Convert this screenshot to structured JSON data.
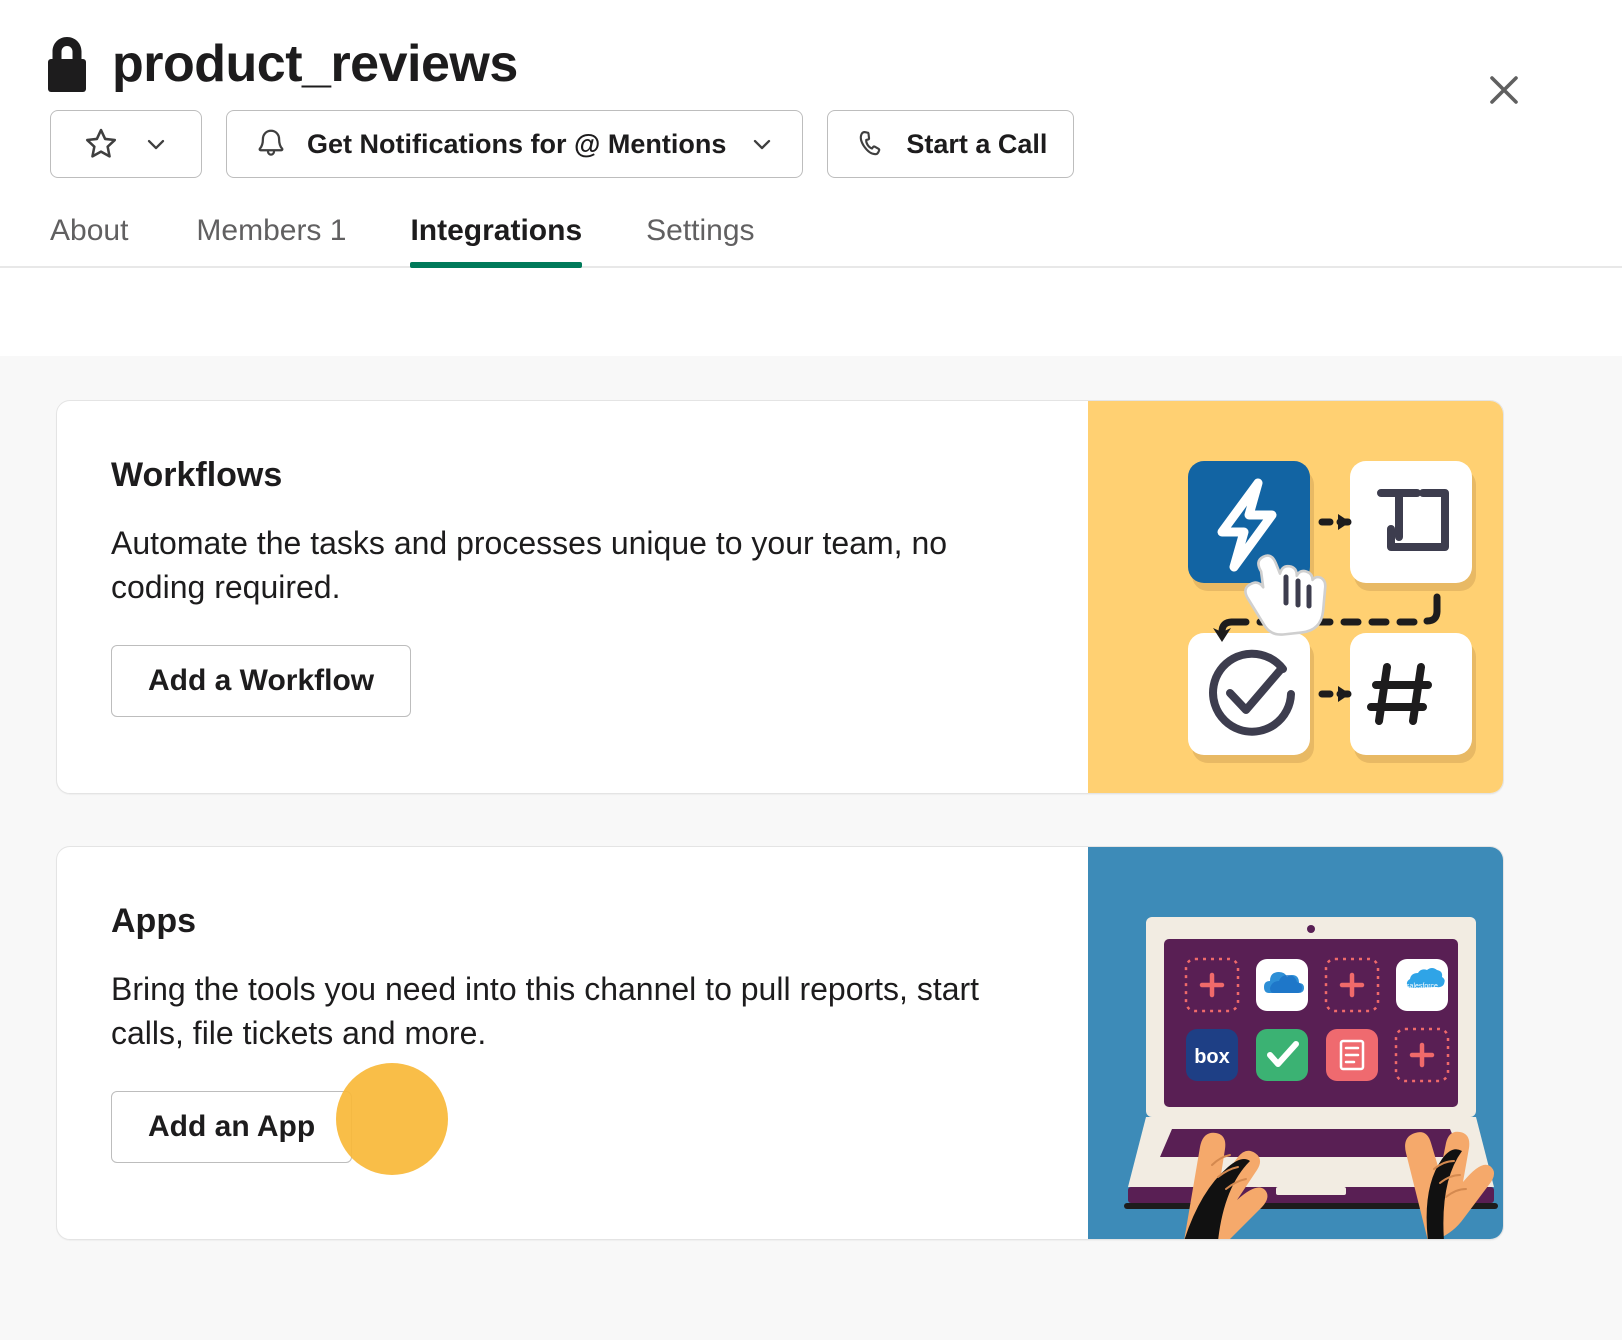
{
  "header": {
    "channel_name": "product_reviews",
    "lock_icon": "lock-icon",
    "close_icon": "close-icon",
    "buttons": {
      "star": {
        "icon": "star-icon",
        "chevron": "chevron-down-icon",
        "label": ""
      },
      "notifications": {
        "icon": "bell-icon",
        "label": "Get Notifications for @ Mentions",
        "chevron": "chevron-down-icon"
      },
      "call": {
        "icon": "phone-icon",
        "label": "Start a Call"
      }
    }
  },
  "tabs": [
    {
      "label": "About",
      "active": false
    },
    {
      "label": "Members 1",
      "active": false
    },
    {
      "label": "Integrations",
      "active": true
    },
    {
      "label": "Settings",
      "active": false
    }
  ],
  "cards": [
    {
      "title": "Workflows",
      "description": "Automate the tasks and processes unique to your team, no coding required.",
      "button_label": "Add a Workflow",
      "art": {
        "name": "workflow-builder-illustration",
        "background": "#ffd072",
        "tiles": [
          "bolt-icon",
          "text-input-icon",
          "check-circle-icon",
          "hash-icon"
        ],
        "cursor": "pointing-hand-cursor",
        "bolt_tile_color": "#1264a3"
      }
    },
    {
      "title": "Apps",
      "description": "Bring the tools you need into this channel to pull reports, start calls, file tickets and more.",
      "button_label": "Add an App",
      "art": {
        "name": "laptop-apps-illustration",
        "background": "#3d8bb8",
        "screen_color": "#591f54",
        "apps": [
          "add-placeholder",
          "onedrive-icon",
          "add-placeholder",
          "salesforce-icon",
          "box-icon",
          "check-icon",
          "evernote-icon",
          "add-placeholder"
        ]
      }
    }
  ],
  "overlay": {
    "click_indicator": {
      "name": "click-indicator",
      "color": "#f8b938"
    }
  },
  "colors": {
    "accent_green": "#007a5a",
    "page_background": "#f8f8f8",
    "text_primary": "#1d1c1d",
    "text_secondary": "#616061"
  }
}
